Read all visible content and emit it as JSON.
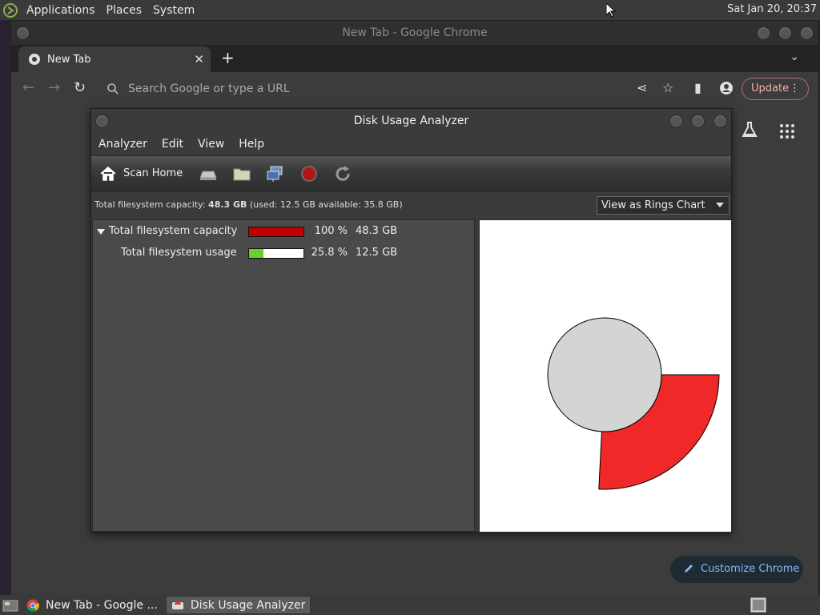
{
  "panel": {
    "menus": [
      "Applications",
      "Places",
      "System"
    ],
    "clock": "Sat Jan 20, 20:37"
  },
  "chrome": {
    "window_title": "New Tab - Google Chrome",
    "tab_title": "New Tab",
    "omnibox_placeholder": "Search Google or type a URL",
    "update_label": "Update",
    "customize_label": "Customize Chrome"
  },
  "dua": {
    "window_title": "Disk Usage Analyzer",
    "menu": [
      "Analyzer",
      "Edit",
      "View",
      "Help"
    ],
    "scan_home_label": "Scan Home",
    "info": {
      "prefix": "Total filesystem capacity: ",
      "capacity": "48.3 GB",
      "suffix": " (used: 12.5 GB available: 35.8 GB)"
    },
    "view_select": "View as Rings Chart",
    "rows": [
      {
        "name": "Total filesystem capacity",
        "percent_text": "100 %",
        "size": "48.3 GB",
        "fill_fraction": 1.0,
        "fill_color": "#c00000"
      },
      {
        "name": "Total filesystem usage",
        "percent_text": "25.8 %",
        "size": "12.5 GB",
        "fill_fraction": 0.258,
        "fill_color": "#6ad02a"
      }
    ],
    "rings": {
      "used_fraction": 0.258,
      "center_color": "#d3d5d2",
      "used_color": "#ef2929"
    }
  },
  "taskbar": {
    "tasks": [
      "New Tab - Google ...",
      "Disk Usage Analyzer"
    ]
  }
}
